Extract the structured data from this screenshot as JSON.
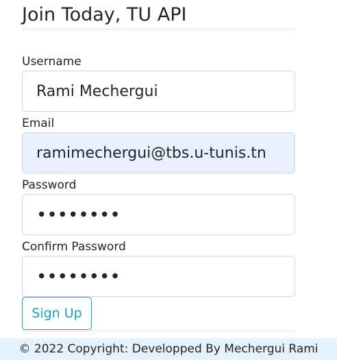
{
  "form": {
    "title": "Join Today, TU API",
    "username": {
      "label": "Username",
      "value": "Rami Mechergui"
    },
    "email": {
      "label": "Email",
      "value": "ramimechergui@tbs.u-tunis.tn"
    },
    "password": {
      "label": "Password",
      "value": "••••••••"
    },
    "confirm_password": {
      "label": "Confirm Password",
      "value": "••••••••"
    },
    "submit_label": "Sign Up"
  },
  "footer": {
    "text": "© 2022 Copyright: Developped By Mechergui Rami"
  },
  "colors": {
    "accent": "#17a2b8",
    "autofill_bg": "#e8f0fe",
    "footer_bg": "#e3f2fd"
  }
}
